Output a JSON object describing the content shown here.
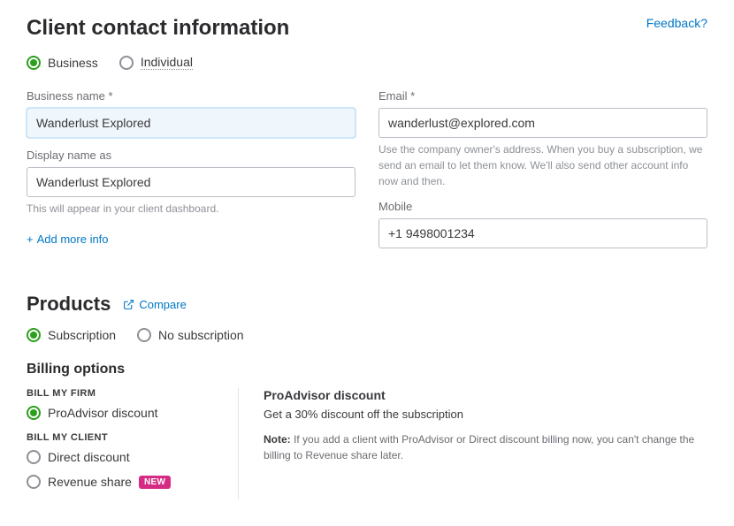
{
  "header": {
    "title": "Client contact information",
    "feedback": "Feedback?"
  },
  "contact_type": {
    "business": "Business",
    "individual": "Individual"
  },
  "fields": {
    "business_name": {
      "label": "Business name *",
      "value": "Wanderlust Explored"
    },
    "display_name": {
      "label": "Display name as",
      "value": "Wanderlust Explored",
      "help": "This will appear in your client dashboard."
    },
    "email": {
      "label": "Email *",
      "value": "wanderlust@explored.com",
      "help": "Use the company owner's address. When you buy a subscription, we send an email to let them know. We'll also send other account info now and then."
    },
    "mobile": {
      "label": "Mobile",
      "value": "+1 9498001234"
    }
  },
  "add_more": "Add more info",
  "products": {
    "title": "Products",
    "compare": "Compare",
    "subscription": "Subscription",
    "no_subscription": "No subscription"
  },
  "billing": {
    "title": "Billing options",
    "bill_firm": "BILL MY FIRM",
    "proadvisor": "ProAdvisor discount",
    "bill_client": "BILL MY CLIENT",
    "direct": "Direct discount",
    "revenue": "Revenue share",
    "new_badge": "NEW",
    "panel_title": "ProAdvisor discount",
    "panel_sub": "Get a 30% discount off the subscription",
    "panel_note_label": "Note:",
    "panel_note": "If you add a client with ProAdvisor or Direct discount billing now, you can't change the billing to Revenue share later."
  }
}
